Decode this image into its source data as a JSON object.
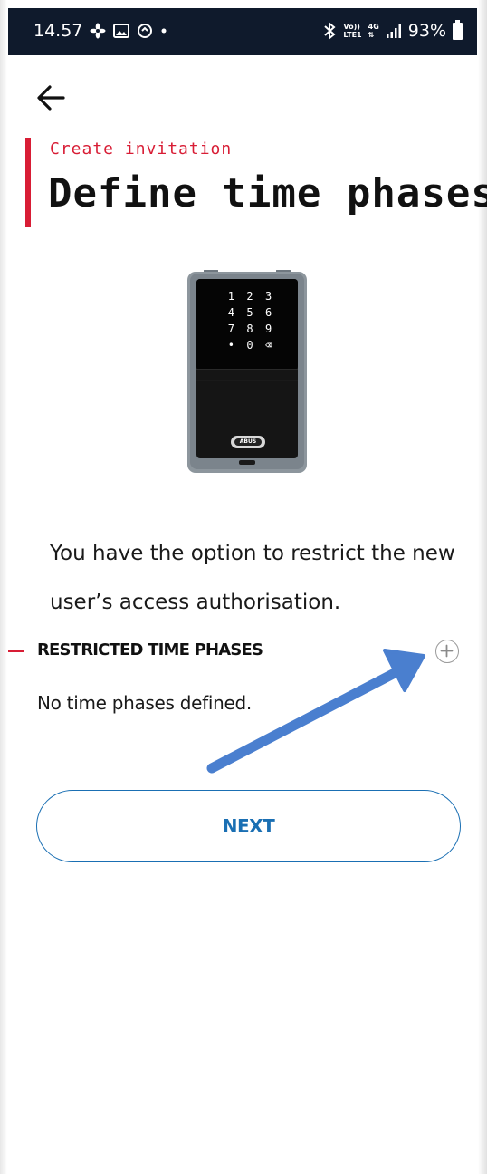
{
  "status_bar": {
    "time": "14.57",
    "battery": "93%",
    "left_icons": [
      "fan-icon",
      "image-icon",
      "sync-icon",
      "dot-icon"
    ],
    "right_icons": [
      "bluetooth-icon",
      "volte-icon",
      "4g-icon",
      "signal-icon",
      "battery-icon"
    ],
    "volte_top": "Vo))",
    "volte_bottom": "LTE1",
    "net_top": "4G",
    "net_bottom": "⇅"
  },
  "header": {
    "back_icon": "arrow-left-icon",
    "subtitle": "Create invitation",
    "title": "Define time phases"
  },
  "device": {
    "keypad": [
      "1",
      "2",
      "3",
      "4",
      "5",
      "6",
      "7",
      "8",
      "9",
      "•",
      "0",
      "⌫"
    ],
    "brand": "ABUS"
  },
  "description": "You have the option to restrict the new user’s access authorisation.",
  "restricted_section": {
    "title": "RESTRICTED TIME PHASES",
    "empty_text": "No time phases defined.",
    "add_icon": "plus-circle-icon"
  },
  "next_button": {
    "label": "NEXT"
  },
  "colors": {
    "accent": "#d81d35",
    "primary": "#1a6fb3",
    "status_bar": "#0f1a2c",
    "annotation_arrow": "#4a7fcf"
  }
}
